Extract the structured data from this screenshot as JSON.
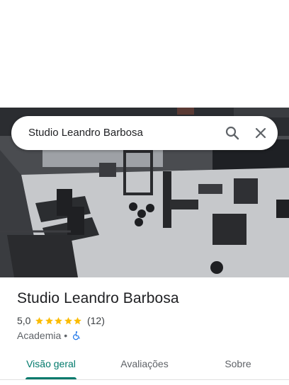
{
  "search": {
    "query": "Studio Leandro Barbosa"
  },
  "place": {
    "title": "Studio Leandro Barbosa",
    "rating": "5,0",
    "stars": 5,
    "review_count": "(12)",
    "category": "Academia",
    "separator": "•",
    "accessibility_icon": "wheelchair-icon"
  },
  "tabs": [
    {
      "label": "Visão geral",
      "active": true
    },
    {
      "label": "Avaliações",
      "active": false
    },
    {
      "label": "Sobre",
      "active": false
    }
  ],
  "colors": {
    "accent": "#00796b",
    "star": "#fbbc04",
    "accessibility": "#1a73e8",
    "text_primary": "#202124",
    "text_secondary": "#5f6368"
  },
  "icons": {
    "search": "search-icon",
    "close": "close-icon",
    "star": "star-icon"
  }
}
